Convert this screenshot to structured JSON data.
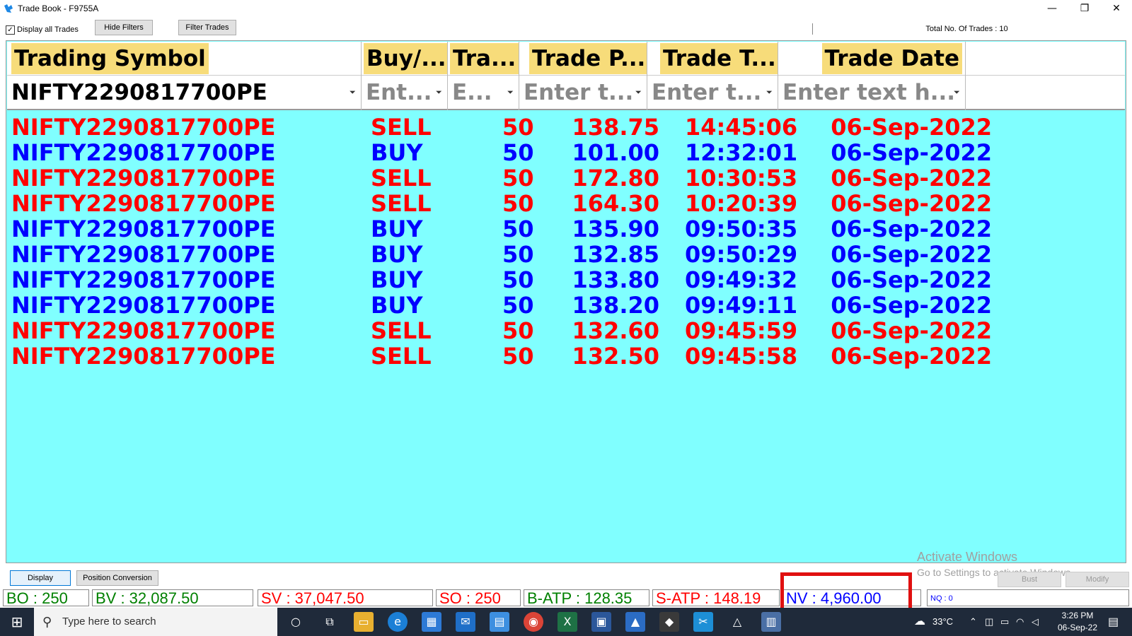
{
  "window": {
    "title": "Trade Book - F9755A",
    "minimize": "—",
    "maximize": "❐",
    "close": "✕"
  },
  "toolbar": {
    "display_all_label": "Display all Trades",
    "display_all_checked": true,
    "hide_filters_label": "Hide Filters",
    "filter_trades_label": "Filter Trades",
    "total_trades": "Total No. Of Trades : 10"
  },
  "columns": [
    {
      "label": "Trading Symbol",
      "filter": "NIFTY2290817700PE"
    },
    {
      "label": "Buy/...",
      "filter": "Ent..."
    },
    {
      "label": "Tra...",
      "filter": "E..."
    },
    {
      "label": "Trade P...",
      "filter": "Enter t..."
    },
    {
      "label": "Trade T...",
      "filter": "Enter t..."
    },
    {
      "label": "Trade Date",
      "filter": "Enter text h..."
    }
  ],
  "trades": [
    {
      "symbol": "NIFTY2290817700PE",
      "side": "SELL",
      "qty": "50",
      "price": "138.75",
      "time": "14:45:06",
      "date": "06-Sep-2022"
    },
    {
      "symbol": "NIFTY2290817700PE",
      "side": "BUY",
      "qty": "50",
      "price": "101.00",
      "time": "12:32:01",
      "date": "06-Sep-2022"
    },
    {
      "symbol": "NIFTY2290817700PE",
      "side": "SELL",
      "qty": "50",
      "price": "172.80",
      "time": "10:30:53",
      "date": "06-Sep-2022"
    },
    {
      "symbol": "NIFTY2290817700PE",
      "side": "SELL",
      "qty": "50",
      "price": "164.30",
      "time": "10:20:39",
      "date": "06-Sep-2022"
    },
    {
      "symbol": "NIFTY2290817700PE",
      "side": "BUY",
      "qty": "50",
      "price": "135.90",
      "time": "09:50:35",
      "date": "06-Sep-2022"
    },
    {
      "symbol": "NIFTY2290817700PE",
      "side": "BUY",
      "qty": "50",
      "price": "132.85",
      "time": "09:50:29",
      "date": "06-Sep-2022"
    },
    {
      "symbol": "NIFTY2290817700PE",
      "side": "BUY",
      "qty": "50",
      "price": "133.80",
      "time": "09:49:32",
      "date": "06-Sep-2022"
    },
    {
      "symbol": "NIFTY2290817700PE",
      "side": "BUY",
      "qty": "50",
      "price": "138.20",
      "time": "09:49:11",
      "date": "06-Sep-2022"
    },
    {
      "symbol": "NIFTY2290817700PE",
      "side": "SELL",
      "qty": "50",
      "price": "132.60",
      "time": "09:45:59",
      "date": "06-Sep-2022"
    },
    {
      "symbol": "NIFTY2290817700PE",
      "side": "SELL",
      "qty": "50",
      "price": "132.50",
      "time": "09:45:58",
      "date": "06-Sep-2022"
    }
  ],
  "colors": {
    "sell": "#ff0000",
    "buy": "#0000ff",
    "grid_background": "#80ffff",
    "header_label_background": "#f7dc7a",
    "highlight_border": "#e01010"
  },
  "watermark": {
    "line1": "Activate Windows",
    "line2": "Go to Settings to activate Windows."
  },
  "bottom_buttons": {
    "display": "Display",
    "position_conversion": "Position Conversion",
    "bust": "Bust",
    "modify": "Modify"
  },
  "status": {
    "bo": "BO : 250",
    "bv": "BV : 32,087.50",
    "sv": "SV : 37,047.50",
    "so": "SO : 250",
    "b_atp": "B-ATP : 128.35",
    "s_atp": "S-ATP : 148.19",
    "nv": "NV : 4,960.00",
    "nq": "NQ : 0"
  },
  "taskbar": {
    "search_placeholder": "Type here to search",
    "weather": "33°C",
    "time": "3:26 PM",
    "date": "06-Sep-22"
  }
}
